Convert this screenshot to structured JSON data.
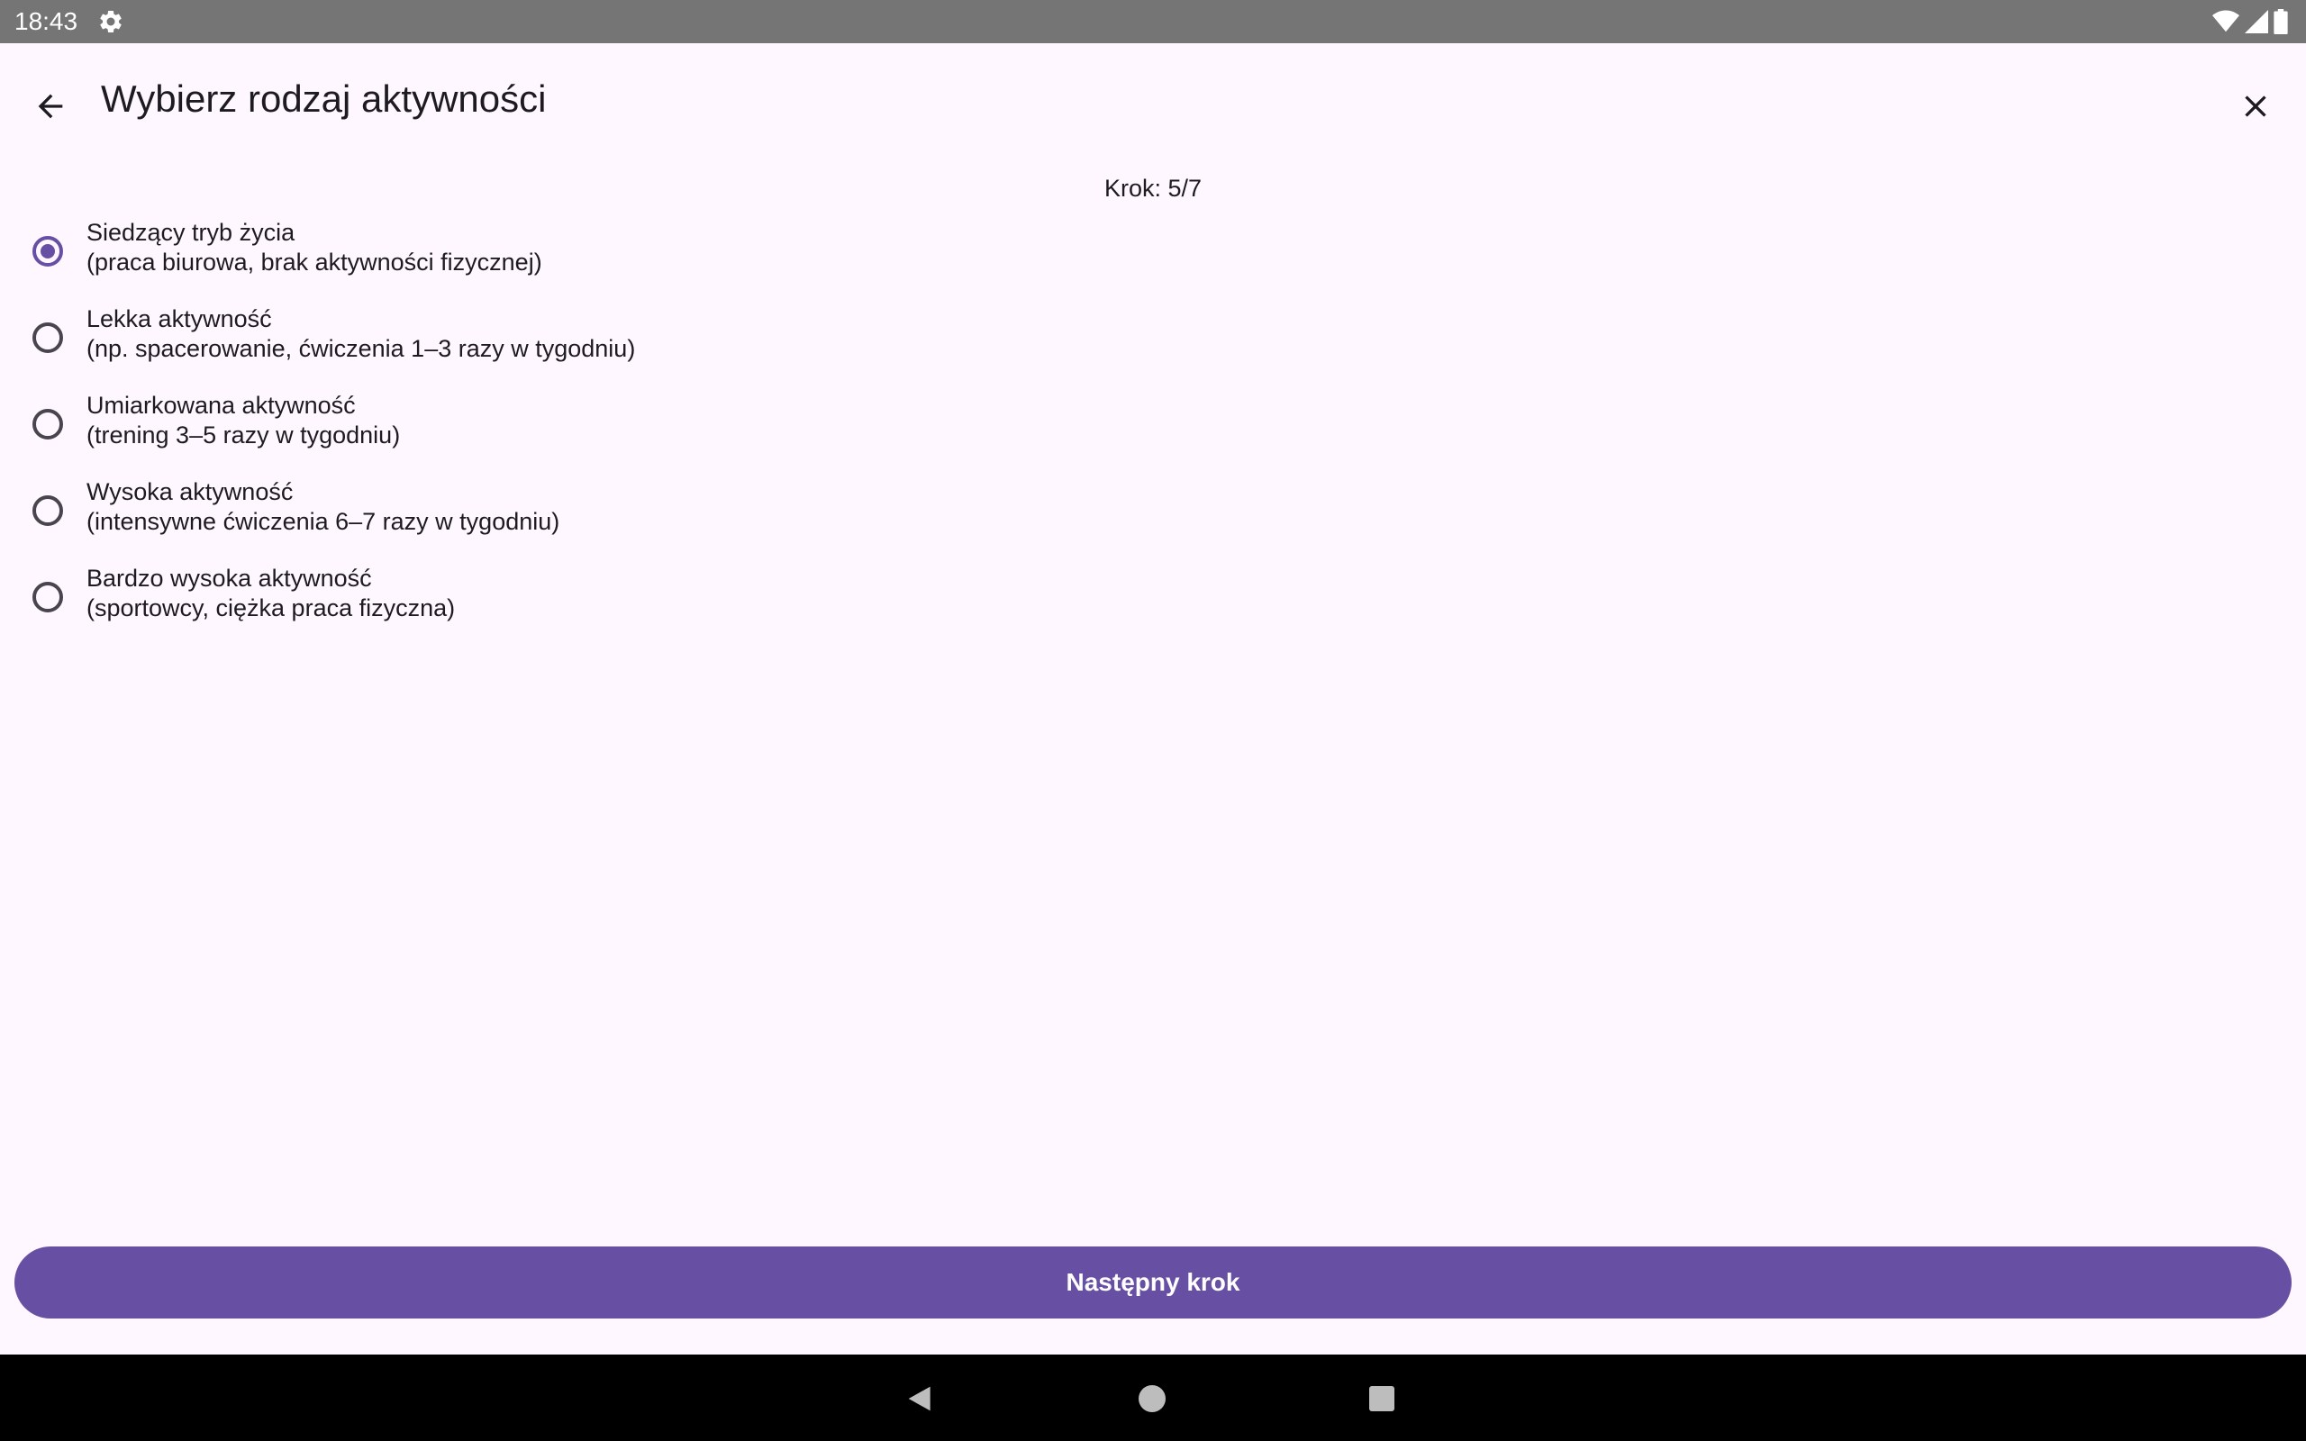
{
  "status_bar": {
    "time": "18:43",
    "icons": [
      "settings-icon",
      "wifi-icon",
      "signal-icon",
      "battery-icon"
    ]
  },
  "header": {
    "title": "Wybierz rodzaj aktywności",
    "back_icon": "arrow-back-icon",
    "close_icon": "close-icon"
  },
  "step": {
    "label": "Krok: 5/7"
  },
  "options": [
    {
      "title": "Siedzący tryb życia",
      "subtitle": "(praca biurowa, brak aktywności fizycznej)",
      "selected": true
    },
    {
      "title": "Lekka aktywność",
      "subtitle": "(np. spacerowanie, ćwiczenia 1–3 razy w tygodniu)",
      "selected": false
    },
    {
      "title": "Umiarkowana aktywność",
      "subtitle": "(trening 3–5 razy w tygodniu)",
      "selected": false
    },
    {
      "title": "Wysoka aktywność",
      "subtitle": "(intensywne ćwiczenia 6–7 razy w tygodniu)",
      "selected": false
    },
    {
      "title": "Bardzo wysoka aktywność",
      "subtitle": "(sportowcy, ciężka praca fizyczna)",
      "selected": false
    }
  ],
  "next_button": {
    "label": "Następny krok"
  },
  "colors": {
    "accent": "#6750a4",
    "background": "#fef7ff",
    "status_bar": "#757575"
  },
  "nav_bar": {
    "icons": [
      "nav-back-icon",
      "nav-home-icon",
      "nav-recents-icon"
    ]
  }
}
